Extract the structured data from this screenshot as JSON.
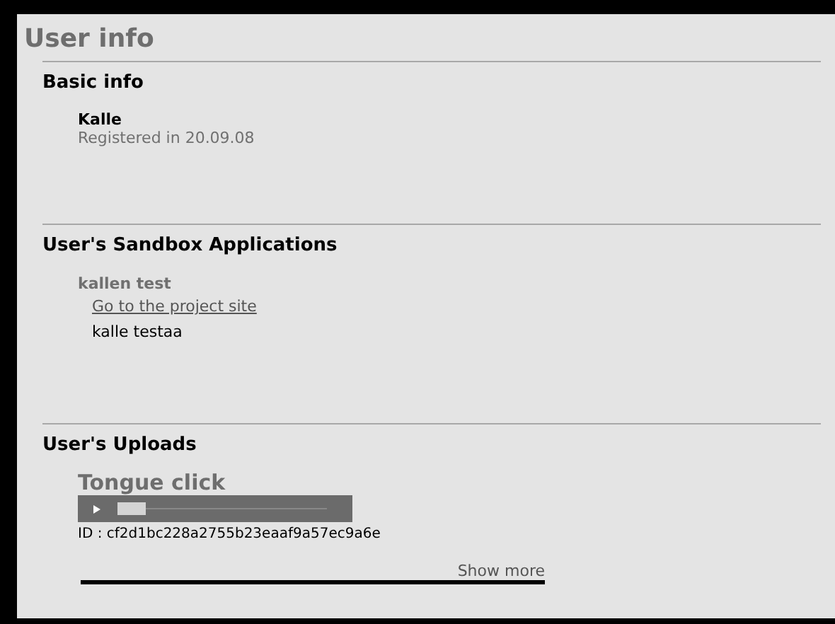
{
  "page_title": "User info",
  "basic_info": {
    "heading": "Basic info",
    "name": "Kalle",
    "registered": "Registered in 20.09.08"
  },
  "sandbox": {
    "heading": "User's Sandbox Applications",
    "apps": [
      {
        "name": "kallen test",
        "link": "Go to the project site",
        "description": "kalle testaa"
      }
    ]
  },
  "uploads": {
    "heading": "User's Uploads",
    "items": [
      {
        "title": "Tongue click",
        "id_text": "ID : cf2d1bc228a2755b23eaaf9a57ec9a6e"
      }
    ],
    "show_more": "Show more"
  }
}
